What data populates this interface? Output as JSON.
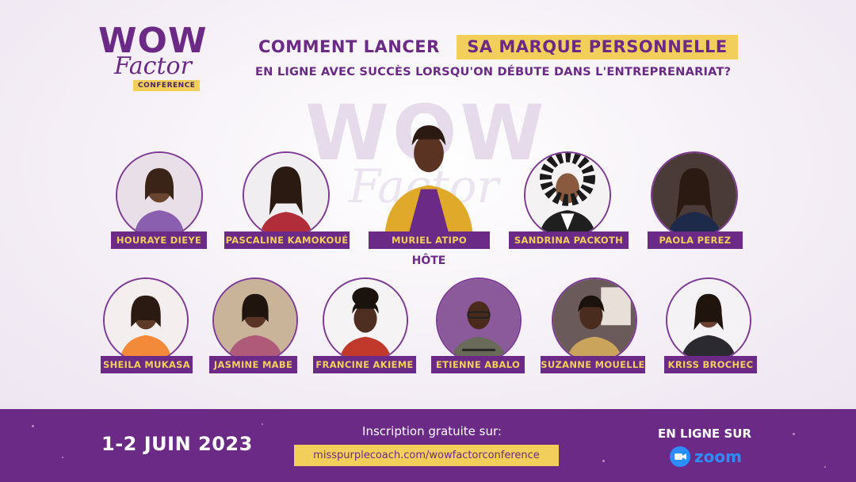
{
  "logo": {
    "line1": "WOW",
    "line2": "Factor",
    "tag": "CONFERENCE"
  },
  "headline": {
    "part1": "COMMENT LANCER",
    "highlight": "SA MARQUE PERSONNELLE",
    "line2": "EN LIGNE AVEC SUCCÈS LORSQU'ON DÉBUTE DANS L'ENTREPRENARIAT?"
  },
  "host_label": "HÔTE",
  "speakers_row1": [
    "HOURAYE DIEYE",
    "PASCALINE KAMOKOUÉ",
    "MURIEL ATIPO",
    "SANDRINA PACKOTH",
    "PAOLA PEREZ"
  ],
  "speakers_row2": [
    "SHEILA MUKASA",
    "JASMINE MABE",
    "FRANCINE AKIEME",
    "ETIENNE ABALO",
    "SUZANNE MOUELLE",
    "KRISS BROCHEC"
  ],
  "footer": {
    "date": "1-2 JUIN 2023",
    "registration_label": "Inscription gratuite sur:",
    "registration_url": "misspurplecoach.com/wowfactorconference",
    "online_label": "EN LIGNE SUR",
    "platform": "zoom"
  },
  "colors": {
    "purple": "#6b2a85",
    "gold": "#f2cf5b",
    "zoom_blue": "#2d8cff"
  }
}
